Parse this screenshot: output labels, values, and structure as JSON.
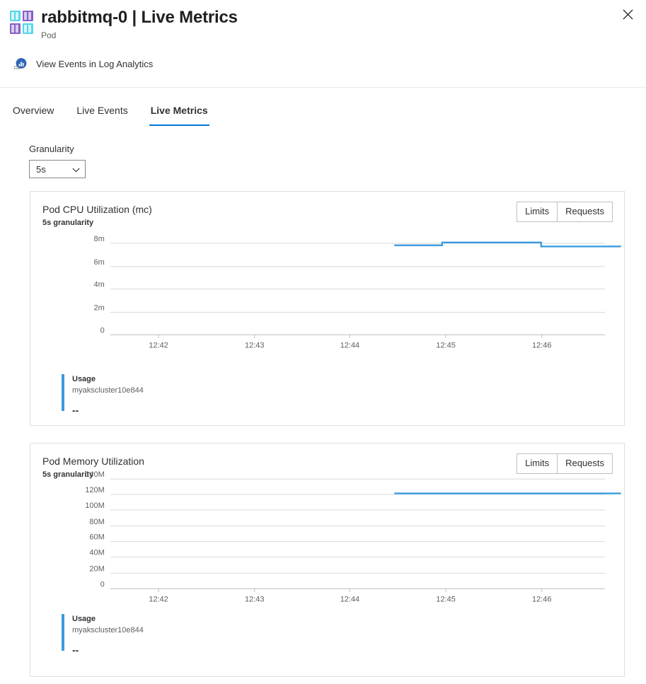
{
  "header": {
    "title": "rabbitmq-0 | Live Metrics",
    "subtitle": "Pod",
    "resource_icon": "pod-grid-icon",
    "close_icon": "close-icon",
    "icon_colors": {
      "cyan": "#55d6e8",
      "purple": "#8661c5"
    }
  },
  "commandbar": {
    "link_label": "View Events in Log Analytics",
    "link_icon": "log-analytics-chart-icon",
    "icon_color": "#3067b5"
  },
  "tabs": [
    {
      "label": "Overview",
      "active": false
    },
    {
      "label": "Live Events",
      "active": false
    },
    {
      "label": "Live Metrics",
      "active": true
    }
  ],
  "granularity": {
    "label": "Granularity",
    "value": "5s",
    "chevron_icon": "chevron-down-icon",
    "options": [
      "5s"
    ]
  },
  "accent_color": "#0078d4",
  "series_color": "#3a9bdc",
  "cards": [
    {
      "id": "cpu",
      "title": "Pod CPU Utilization (mc)",
      "subtitle": "5s granularity",
      "buttons": [
        "Limits",
        "Requests"
      ],
      "legend": {
        "name": "Usage",
        "sub": "myakscluster10e844",
        "value": "--"
      }
    },
    {
      "id": "mem",
      "title": "Pod Memory Utilization",
      "subtitle": "5s granularity",
      "buttons": [
        "Limits",
        "Requests"
      ],
      "legend": {
        "name": "Usage",
        "sub": "myakscluster10e844",
        "value": "--"
      }
    }
  ],
  "chart_data": [
    {
      "type": "line",
      "title": "Pod CPU Utilization (mc)",
      "subtitle": "5s granularity",
      "xlabel": "",
      "ylabel": "",
      "grid": true,
      "legend_position": "below",
      "yticks": [
        "0",
        "2m",
        "4m",
        "6m",
        "8m"
      ],
      "yvalues": [
        0,
        2,
        4,
        6,
        8
      ],
      "ylim": [
        0,
        8.8
      ],
      "xticks": [
        "12:42",
        "12:43",
        "12:44",
        "12:45",
        "12:46"
      ],
      "xlim": [
        "12:41:30",
        "12:46:40"
      ],
      "series": [
        {
          "name": "Usage",
          "sub": "myakscluster10e844",
          "value": "--",
          "points": [
            {
              "x": "12:44:28",
              "y": 7.8
            },
            {
              "x": "12:44:58",
              "y": 7.8
            },
            {
              "x": "12:44:58",
              "y": 8.05
            },
            {
              "x": "12:46:00",
              "y": 8.05
            },
            {
              "x": "12:46:00",
              "y": 7.7
            },
            {
              "x": "12:46:50",
              "y": 7.7
            }
          ]
        }
      ]
    },
    {
      "type": "line",
      "title": "Pod Memory Utilization",
      "subtitle": "5s granularity",
      "xlabel": "",
      "ylabel": "",
      "grid": true,
      "legend_position": "below",
      "yticks": [
        "0",
        "20M",
        "40M",
        "60M",
        "80M",
        "100M",
        "120M",
        "140M"
      ],
      "yvalues": [
        0,
        20,
        40,
        60,
        80,
        100,
        120,
        140
      ],
      "ylim": [
        0,
        147
      ],
      "xticks": [
        "12:42",
        "12:43",
        "12:44",
        "12:45",
        "12:46"
      ],
      "xlim": [
        "12:41:30",
        "12:46:40"
      ],
      "series": [
        {
          "name": "Usage",
          "sub": "myakscluster10e844",
          "value": "--",
          "points": [
            {
              "x": "12:44:28",
              "y": 121
            },
            {
              "x": "12:46:50",
              "y": 121
            }
          ]
        }
      ]
    }
  ]
}
